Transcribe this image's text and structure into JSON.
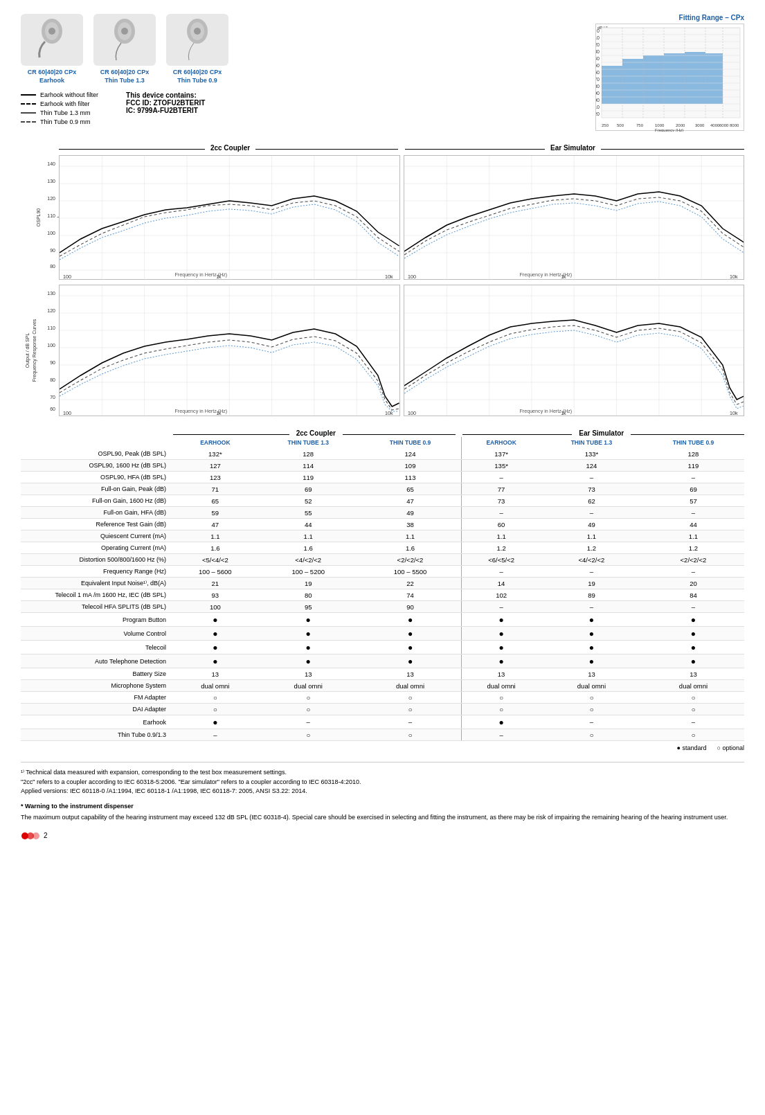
{
  "fitting_range_title": "Fitting Range – CPx",
  "devices": [
    {
      "id": "earhook",
      "model": "CR 60|40|20 CPx",
      "variant": "Earhook",
      "label": "CR 60|40|20 CPx\nEarhook"
    },
    {
      "id": "thin-tube-1.3",
      "model": "CR 60|40|20 CPx",
      "variant": "Thin Tube 1.3",
      "label": "CR 60|40|20 CPx\nThin Tube 1.3"
    },
    {
      "id": "thin-tube-0.9",
      "model": "CR 60|40|20 CPx",
      "variant": "Thin Tube 0.9",
      "label": "CR 60|40|20 CPx\nThin Tube 0.9"
    }
  ],
  "legend": [
    {
      "type": "solid",
      "label": "Earhook without filter"
    },
    {
      "type": "dashed",
      "label": "Earhook with filter"
    },
    {
      "type": "solid-thin",
      "label": "Thin Tube 1.3 mm"
    },
    {
      "type": "dashed-thin",
      "label": "Thin Tube 0.9 mm"
    }
  ],
  "fcc": {
    "title": "This device contains:",
    "fcc_id": "FCC ID: ZTOFU2BTERIT",
    "ic": "IC: 9799A-FU2BTERIT"
  },
  "chart_sections": {
    "coupler": "2cc Coupler",
    "ear_sim": "Ear Simulator"
  },
  "charts": {
    "ospl90_y_label": "OSPL90\nOutput / dB SPL",
    "frc_y_label": "Frequency Response Curves\nOutput / dB SPL",
    "x_label": "Frequency in Hertz (Hz)"
  },
  "table": {
    "coupler_label": "2cc Coupler",
    "ear_sim_label": "Ear Simulator",
    "col_headers": [
      "EARHOOK",
      "THIN TUBE 1.3",
      "THIN TUBE 0.9",
      "EARHOOK",
      "THIN TUBE 1.3",
      "THIN TUBE 0.9"
    ],
    "rows": [
      {
        "label": "OSPL90, Peak (dB SPL)",
        "vals": [
          "132*",
          "128",
          "124",
          "137*",
          "133*",
          "128"
        ]
      },
      {
        "label": "OSPL90, 1600 Hz (dB SPL)",
        "vals": [
          "127",
          "114",
          "109",
          "135*",
          "124",
          "119"
        ]
      },
      {
        "label": "OSPL90, HFA (dB SPL)",
        "vals": [
          "123",
          "119",
          "113",
          "–",
          "–",
          "–"
        ]
      },
      {
        "label": "Full-on Gain, Peak (dB)",
        "vals": [
          "71",
          "69",
          "65",
          "77",
          "73",
          "69"
        ]
      },
      {
        "label": "Full-on Gain, 1600 Hz (dB)",
        "vals": [
          "65",
          "52",
          "47",
          "73",
          "62",
          "57"
        ]
      },
      {
        "label": "Full-on Gain, HFA (dB)",
        "vals": [
          "59",
          "55",
          "49",
          "–",
          "–",
          "–"
        ]
      },
      {
        "label": "Reference Test Gain (dB)",
        "vals": [
          "47",
          "44",
          "38",
          "60",
          "49",
          "44"
        ]
      },
      {
        "label": "Quiescent Current (mA)",
        "vals": [
          "1.1",
          "1.1",
          "1.1",
          "1.1",
          "1.1",
          "1.1"
        ]
      },
      {
        "label": "Operating Current (mA)",
        "vals": [
          "1.6",
          "1.6",
          "1.6",
          "1.2",
          "1.2",
          "1.2"
        ]
      },
      {
        "label": "Distortion 500/800/1600 Hz (%)",
        "vals": [
          "<5/<4/<2",
          "<4/<2/<2",
          "<2/<2/<2",
          "<6/<5/<2",
          "<4/<2/<2",
          "<2/<2/<2"
        ]
      },
      {
        "label": "Frequency Range (Hz)",
        "vals": [
          "100 – 5600",
          "100 – 5200",
          "100 – 5500",
          "–",
          "–",
          "–"
        ]
      },
      {
        "label": "Equivalent Input Noise¹⁾, dB(A)",
        "vals": [
          "21",
          "19",
          "22",
          "14",
          "19",
          "20"
        ]
      },
      {
        "label": "Telecoil 1 mA /m 1600 Hz, IEC (dB SPL)",
        "vals": [
          "93",
          "80",
          "74",
          "102",
          "89",
          "84"
        ]
      },
      {
        "label": "Telecoil HFA SPLITS (dB SPL)",
        "vals": [
          "100",
          "95",
          "90",
          "–",
          "–",
          "–"
        ]
      },
      {
        "label": "Program Button",
        "vals": [
          "●",
          "●",
          "●",
          "●",
          "●",
          "●"
        ],
        "type": "symbol"
      },
      {
        "label": "Volume Control",
        "vals": [
          "●",
          "●",
          "●",
          "●",
          "●",
          "●"
        ],
        "type": "symbol"
      },
      {
        "label": "Telecoil",
        "vals": [
          "●",
          "●",
          "●",
          "●",
          "●",
          "●"
        ],
        "type": "symbol"
      },
      {
        "label": "Auto Telephone Detection",
        "vals": [
          "●",
          "●",
          "●",
          "●",
          "●",
          "●"
        ],
        "type": "symbol"
      },
      {
        "label": "Battery Size",
        "vals": [
          "13",
          "13",
          "13",
          "13",
          "13",
          "13"
        ]
      },
      {
        "label": "Microphone System",
        "vals": [
          "dual omni",
          "dual omni",
          "dual omni",
          "dual omni",
          "dual omni",
          "dual omni"
        ]
      },
      {
        "label": "FM Adapter",
        "vals": [
          "○",
          "○",
          "○",
          "○",
          "○",
          "○"
        ],
        "type": "symbol"
      },
      {
        "label": "DAI Adapter",
        "vals": [
          "○",
          "○",
          "○",
          "○",
          "○",
          "○"
        ],
        "type": "symbol"
      },
      {
        "label": "Earhook",
        "vals": [
          "●",
          "–",
          "–",
          "●",
          "–",
          "–"
        ],
        "type": "symbol"
      },
      {
        "label": "Thin Tube 0.9/1.3",
        "vals": [
          "–",
          "○",
          "○",
          "–",
          "○",
          "○"
        ],
        "type": "symbol"
      }
    ]
  },
  "legend_bottom": {
    "standard": "● standard",
    "optional": "○ optional"
  },
  "footnotes": [
    "¹⁾ Technical data measured with expansion, corresponding to the test box measurement settings.",
    "\"2cc\" refers to a coupler according to IEC 60318-5:2006. \"Ear simulator\" refers to a coupler according to IEC 60318-4:2010.",
    "Applied versions: IEC 60118-0 /A1:1994, IEC 60118-1 /A1:1998, IEC 60118-7: 2005, ANSI S3.22: 2014."
  ],
  "warning": {
    "title": "* Warning to the instrument dispenser",
    "text": "The maximum output capability of the hearing instrument may exceed 132 dB SPL (IEC 60318-4). Special care should be exercised in selecting and fitting the instrument, as there may be risk of impairing the remaining hearing of the hearing instrument user."
  },
  "page_number": "2"
}
